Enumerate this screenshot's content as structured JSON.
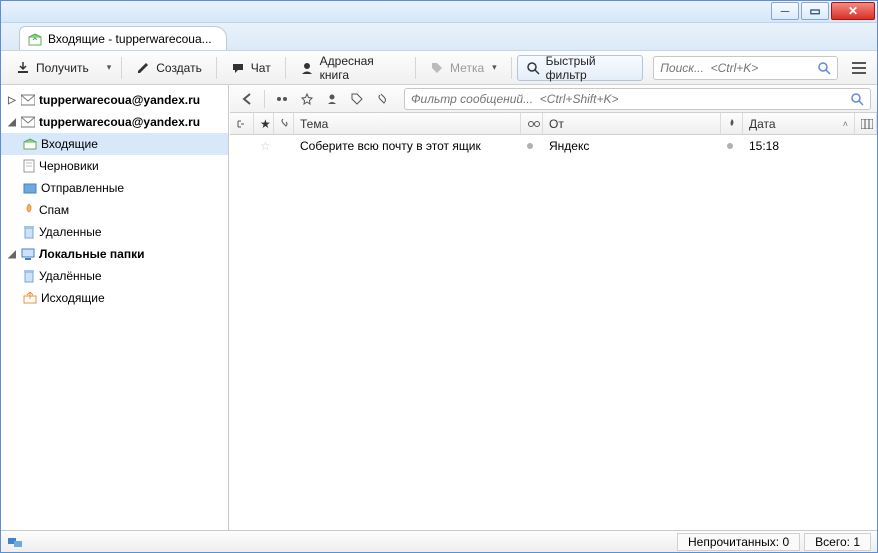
{
  "tab_title": "Входящие - tupperwarecoua...",
  "toolbar": {
    "get": "Получить",
    "create": "Создать",
    "chat": "Чат",
    "addressbook": "Адресная книга",
    "tag": "Метка",
    "quickfilter": "Быстрый фильтр",
    "search_placeholder": "Поиск...  <Ctrl+K>"
  },
  "accounts": [
    {
      "name": "tupperwarecoua@yandex.ru",
      "bold": true
    },
    {
      "name": "tupperwarecoua@yandex.ru",
      "bold": true
    }
  ],
  "folders": {
    "inbox": "Входящие",
    "drafts": "Черновики",
    "sent": "Отправленные",
    "spam": "Спам",
    "trash": "Удаленные",
    "local": "Локальные папки",
    "local_trash": "Удалённые",
    "outbox": "Исходящие"
  },
  "filter_placeholder": "Фильтр сообщений...  <Ctrl+Shift+K>",
  "columns": {
    "subject": "Тема",
    "from": "От",
    "date": "Дата"
  },
  "messages": [
    {
      "subject": "Соберите всю почту в этот ящик",
      "from": "Яндекс",
      "date": "15:18"
    }
  ],
  "status": {
    "unread_label": "Непрочитанных:",
    "unread": "0",
    "total_label": "Всего:",
    "total": "1"
  }
}
